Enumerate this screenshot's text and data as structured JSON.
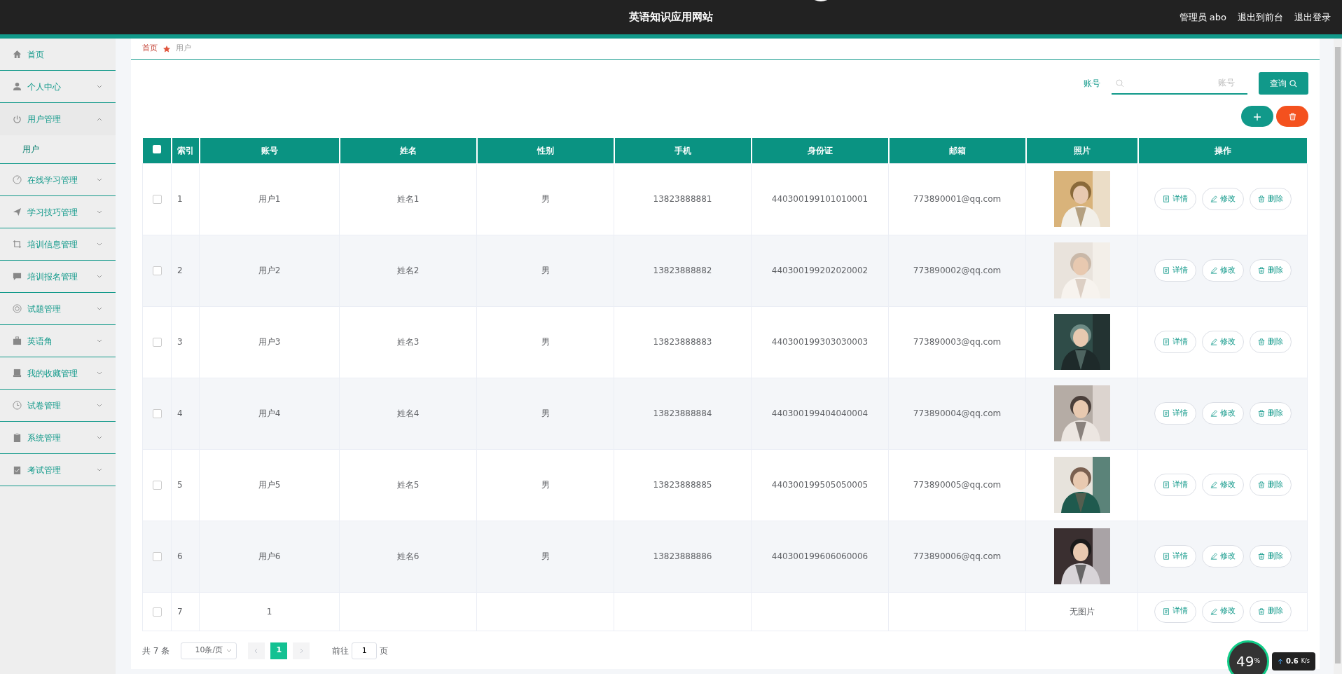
{
  "header": {
    "title": "英语知识应用网站",
    "links": [
      {
        "label": "管理员 abo"
      },
      {
        "label": "退出到前台"
      },
      {
        "label": "退出登录"
      }
    ]
  },
  "sidebar": {
    "items": [
      {
        "label": "首页"
      },
      {
        "label": "个人中心",
        "expanded": false
      },
      {
        "label": "用户管理",
        "expanded": true,
        "children": [
          {
            "label": "用户",
            "selected": true
          }
        ]
      },
      {
        "label": "在线学习管理",
        "expanded": false
      },
      {
        "label": "学习技巧管理",
        "expanded": false
      },
      {
        "label": "培训信息管理",
        "expanded": false
      },
      {
        "label": "培训报名管理",
        "expanded": false
      },
      {
        "label": "试题管理",
        "expanded": false
      },
      {
        "label": "英语角",
        "expanded": false
      },
      {
        "label": "我的收藏管理",
        "expanded": false
      },
      {
        "label": "试卷管理",
        "expanded": false
      },
      {
        "label": "系统管理",
        "expanded": false
      },
      {
        "label": "考试管理",
        "expanded": false
      }
    ]
  },
  "breadcrumb": [
    {
      "label": "首页"
    },
    {
      "label": "用户"
    }
  ],
  "search": {
    "label": "账号",
    "placeholder": "账号",
    "button": "查询"
  },
  "table": {
    "select_all_checked": false,
    "columns": [
      "索引",
      "账号",
      "姓名",
      "性别",
      "手机",
      "身份证",
      "邮箱",
      "照片",
      "操作"
    ],
    "rows": [
      {
        "checked": false,
        "cells": [
          "1",
          "用户1",
          "姓名1",
          "男",
          "13823888881",
          "440300199101010001",
          "773890001@qq.com"
        ],
        "actions": [
          "详情",
          "修改",
          "删除"
        ]
      },
      {
        "checked": false,
        "cells": [
          "2",
          "用户2",
          "姓名2",
          "男",
          "13823888882",
          "440300199202020002",
          "773890002@qq.com"
        ],
        "actions": [
          "详情",
          "修改",
          "删除"
        ]
      },
      {
        "checked": false,
        "cells": [
          "3",
          "用户3",
          "姓名3",
          "男",
          "13823888883",
          "440300199303030003",
          "773890003@qq.com"
        ],
        "actions": [
          "详情",
          "修改",
          "删除"
        ]
      },
      {
        "checked": false,
        "cells": [
          "4",
          "用户4",
          "姓名4",
          "男",
          "13823888884",
          "440300199404040004",
          "773890004@qq.com"
        ],
        "actions": [
          "详情",
          "修改",
          "删除"
        ]
      },
      {
        "checked": false,
        "cells": [
          "5",
          "用户5",
          "姓名5",
          "男",
          "13823888885",
          "440300199505050005",
          "773890005@qq.com"
        ],
        "actions": [
          "详情",
          "修改",
          "删除"
        ]
      },
      {
        "checked": false,
        "cells": [
          "6",
          "用户6",
          "姓名6",
          "男",
          "13823888886",
          "440300199606060006",
          "773890006@qq.com"
        ],
        "actions": [
          "详情",
          "修改",
          "删除"
        ]
      },
      {
        "checked": false,
        "cells": [
          "7",
          "1"
        ],
        "photo": {
          "kind": "none",
          "text": "无图片"
        },
        "actions": [
          "详情",
          "修改",
          "删除"
        ]
      }
    ]
  },
  "pagination": {
    "total": "共 7 条",
    "page_size": "10条/页",
    "pages": [
      {
        "label": "1",
        "selected": true
      }
    ],
    "goto_label": "前往",
    "goto_value": "1",
    "goto_suffix": "页"
  },
  "speed_widget": {
    "percent": "49",
    "percent_unit": "%",
    "speed": "0.6",
    "speed_unit": "K/s"
  }
}
